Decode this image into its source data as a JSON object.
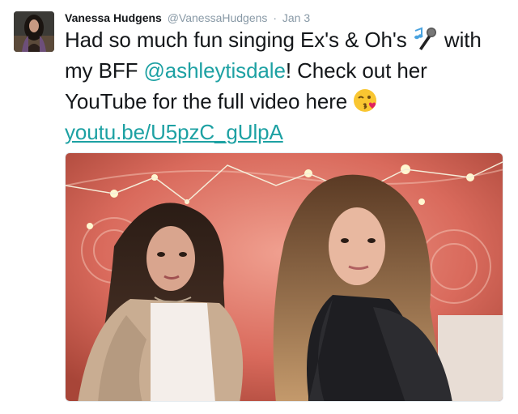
{
  "tweet": {
    "author_name": "Vanessa Hudgens",
    "author_handle": "@VanessaHudgens",
    "separator": "·",
    "date": "Jan 3",
    "text_part1": "Had so much fun singing Ex's & Oh's ",
    "text_part2": " with my BFF ",
    "mention": "@ashleytisdale",
    "text_part3": "! Check out her YouTube for the full video here ",
    "link": "youtu.be/U5pzC_gUlpA"
  },
  "icons": {
    "emoji_1": "microphone-music-emoji-icon",
    "emoji_2": "kissing-wink-emoji-icon"
  },
  "colors": {
    "link": "#1da1a3",
    "name": "#14171a",
    "meta": "#8899a6"
  }
}
